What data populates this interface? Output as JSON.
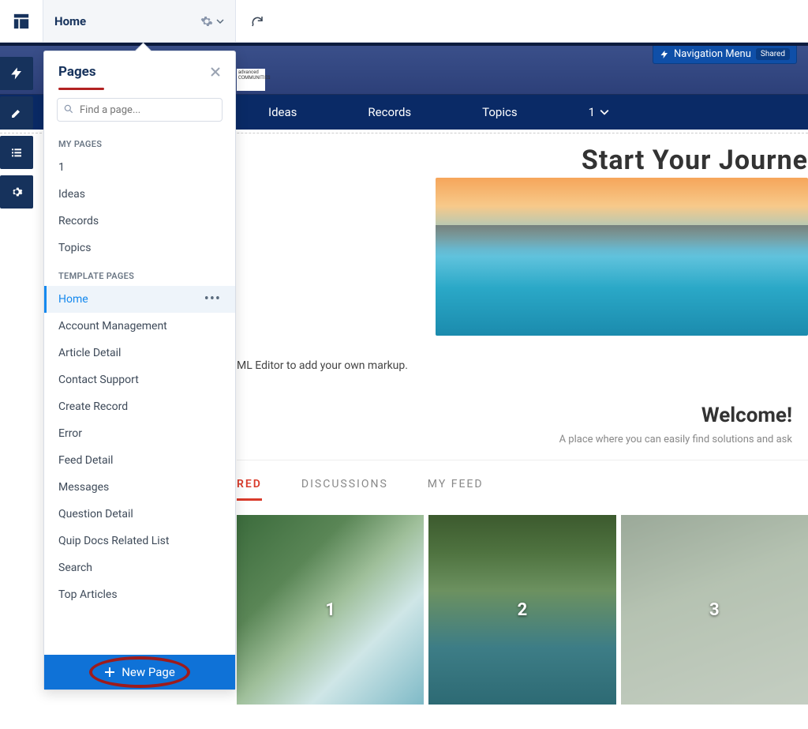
{
  "topbar": {
    "home_label": "Home"
  },
  "hero": {
    "brand_line1": "advanced",
    "brand_line2": "COMMUNITIES",
    "nav_menu_label": "Navigation Menu",
    "shared_badge": "Shared"
  },
  "site_nav": {
    "items": [
      "Ideas",
      "Records",
      "Topics",
      "1"
    ]
  },
  "main": {
    "headline": "Start Your Journe",
    "editor_hint": "ML Editor to add your own markup.",
    "welcome_title": "Welcome!",
    "welcome_sub": "A place where you can easily find solutions and ask"
  },
  "tabs": {
    "active": "RED",
    "items": [
      "RED",
      "DISCUSSIONS",
      "MY FEED"
    ]
  },
  "cards": [
    "1",
    "2",
    "3"
  ],
  "popover": {
    "title": "Pages",
    "search_placeholder": "Find a page...",
    "section_my": "MY PAGES",
    "my_pages": [
      "1",
      "Ideas",
      "Records",
      "Topics"
    ],
    "section_tpl": "TEMPLATE PAGES",
    "template_pages": [
      "Home",
      "Account Management",
      "Article Detail",
      "Contact Support",
      "Create Record",
      "Error",
      "Feed Detail",
      "Messages",
      "Question Detail",
      "Quip Docs Related List",
      "Search",
      "Top Articles"
    ],
    "active_template": "Home",
    "new_page_label": "New Page"
  }
}
